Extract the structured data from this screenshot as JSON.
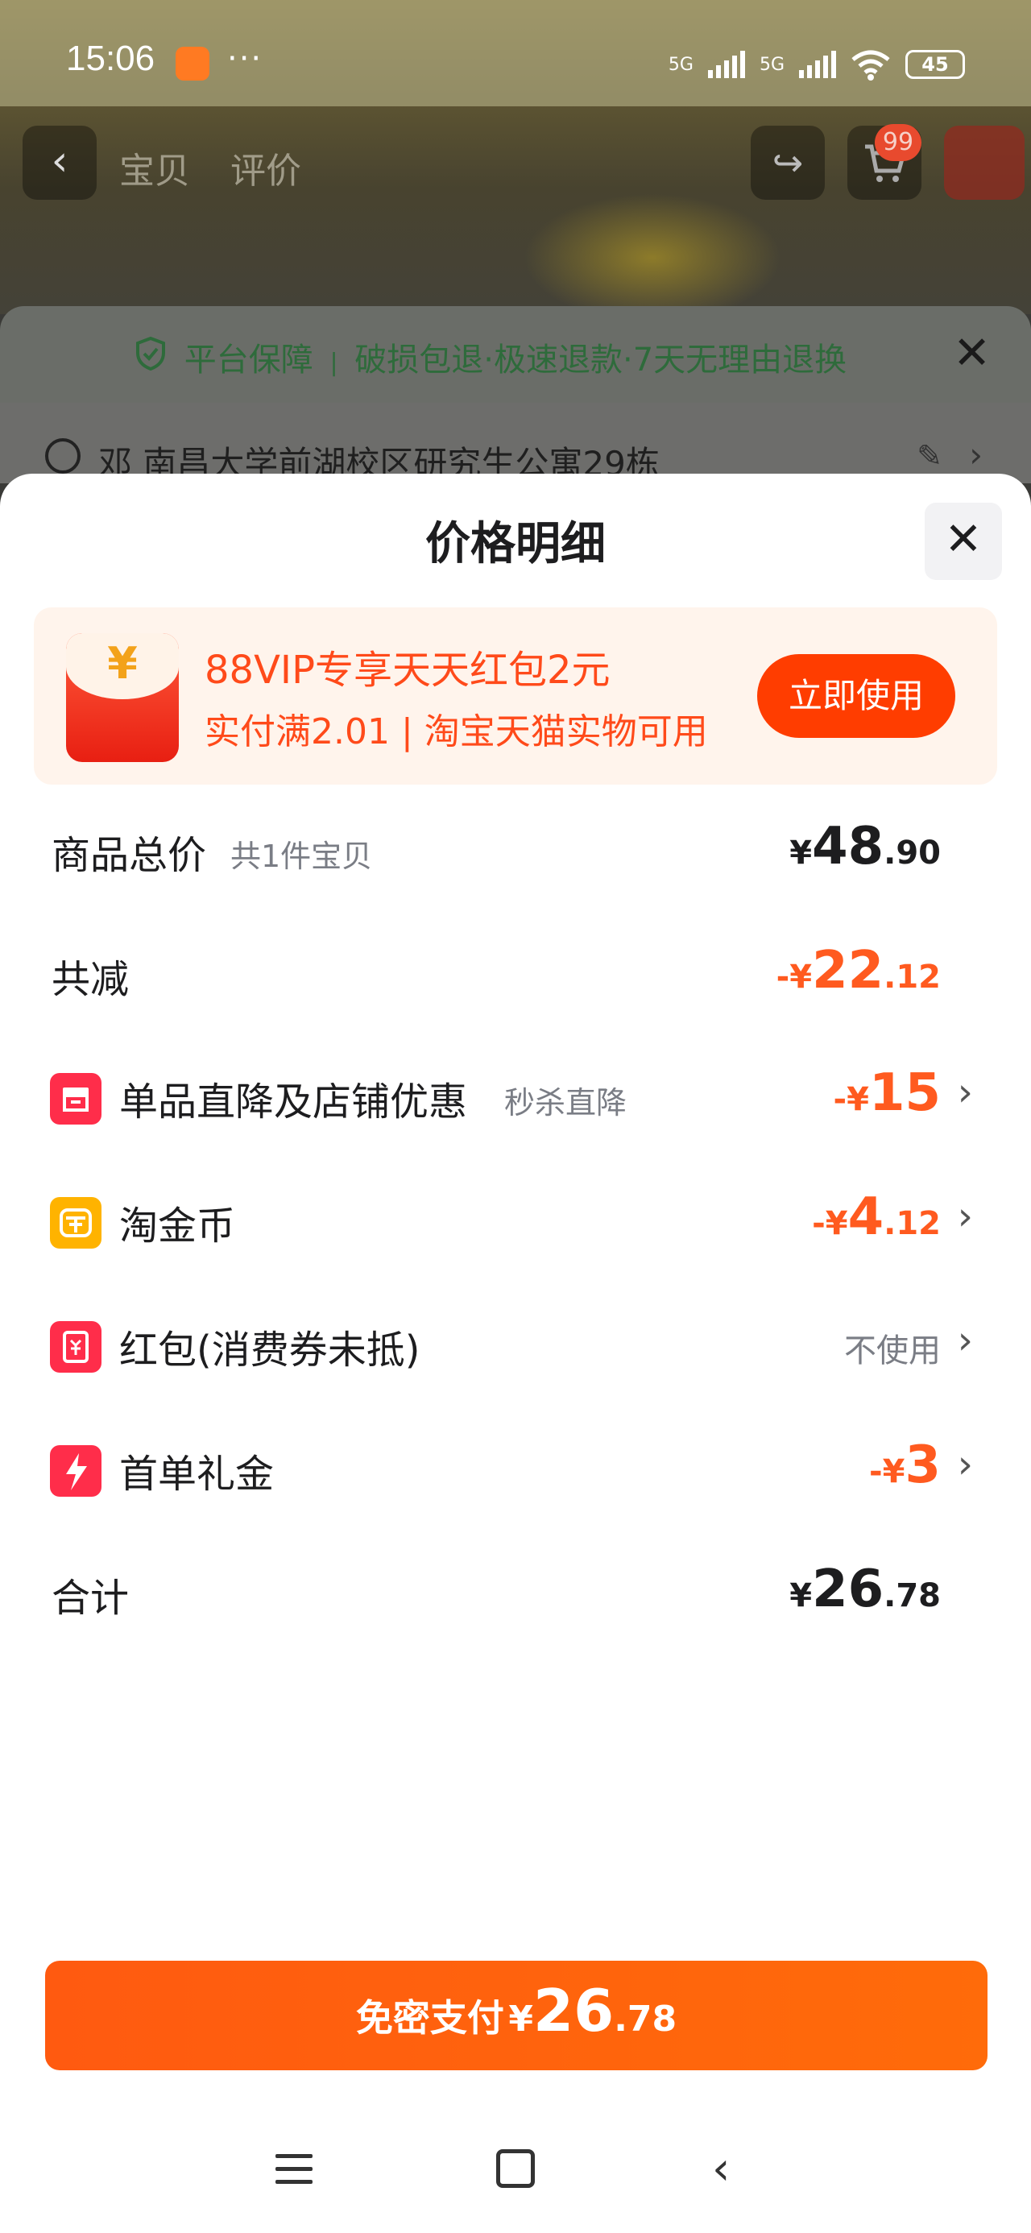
{
  "status_bar": {
    "time": "15:06",
    "more": "···",
    "net1": "5G",
    "net2": "5G",
    "battery": "45"
  },
  "nav": {
    "back_icon": "‹",
    "tab1": "宝贝",
    "tab2": "评价",
    "share_icon": "↪",
    "cart_badge": "99"
  },
  "guarantee": {
    "label": "平台保障",
    "separator": "|",
    "items": "破损包退·极速退款·7天无理由退换",
    "close": "✕"
  },
  "address": {
    "name": "邓",
    "text": "南昌大学前湖校区研究生公寓29栋"
  },
  "sheet": {
    "title": "价格明细",
    "close": "✕"
  },
  "promo": {
    "title": "88VIP专享天天红包2元",
    "subtitle": "实付满2.01 | 淘宝天猫实物可用",
    "button": "立即使用",
    "envelope_symbol": "¥"
  },
  "rows": {
    "total": {
      "label": "商品总价",
      "sub": "共1件宝贝",
      "cur": "¥",
      "int": "48",
      "dec": ".90"
    },
    "reduce": {
      "label": "共减",
      "cur": "-¥",
      "int": "22",
      "dec": ".12"
    },
    "shop": {
      "label": "单品直降及店铺优惠",
      "sub": "秒杀直降",
      "cur": "-¥",
      "int": "15",
      "dec": ""
    },
    "coin": {
      "label": "淘金币",
      "cur": "-¥",
      "int": "4",
      "dec": ".12"
    },
    "redpacket": {
      "label": "红包(消费券未抵)",
      "value": "不使用"
    },
    "first_order": {
      "label": "首单礼金",
      "cur": "-¥",
      "int": "3",
      "dec": ""
    },
    "sum": {
      "label": "合计",
      "cur": "¥",
      "int": "26",
      "dec": ".78"
    }
  },
  "arrow": "›",
  "pay_button": {
    "label": "免密支付",
    "cur": "¥",
    "int": "26",
    "dec": ".78"
  },
  "colors": {
    "accent": "#ff5a1f",
    "pay_button": "#ff5a10",
    "promo_bg": "#fff4ec",
    "promo_button": "#ff3d00"
  }
}
